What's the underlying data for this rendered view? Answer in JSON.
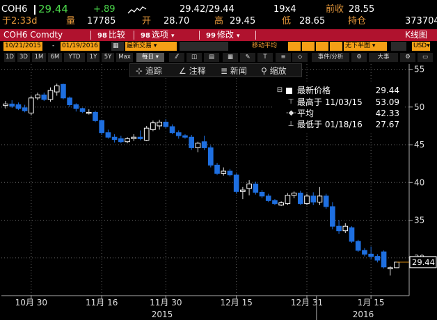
{
  "quote": {
    "ticker": "COH6",
    "last": "29.44",
    "change": "+.89",
    "bid_ask": "29.42/29.44",
    "size": "19x4",
    "prev_close_label": "前收",
    "prev_close": "28.55",
    "time_label": "于",
    "time": "2:33d",
    "volume_label": "量",
    "volume": "17785",
    "open_label": "开",
    "open": "28.70",
    "high_label": "高",
    "high": "29.45",
    "low_label": "低",
    "low": "28.65",
    "oi_label": "持仓",
    "oi": "373704"
  },
  "titlebar": {
    "security": "COH6 Comdty",
    "compare_num": "98",
    "compare": "比较",
    "options_num": "98",
    "options": "选项",
    "edit_num": "99",
    "edit": "修改",
    "chart_type": "K线图"
  },
  "controls": {
    "start_date": "10/21/2015",
    "end_date": "01/19/2016",
    "last_trade": "最新交易",
    "moving_avg": "移动平均",
    "no_lower": "无下半图",
    "currency": "USD"
  },
  "ranges": [
    "1D",
    "3D",
    "1M",
    "6M",
    "YTD",
    "1Y",
    "5Y",
    "Max"
  ],
  "range_selected": "每日",
  "toolbar": {
    "event_label": "事件/分析",
    "large_label": "大事"
  },
  "tools": {
    "track": "追踪",
    "annotate": "注释",
    "news": "新闻",
    "zoom": "缩放"
  },
  "legend": {
    "last_label": "最新价格",
    "last_value": "29.44",
    "high_label": "最高于 11/03/15",
    "high_value": "53.09",
    "avg_label": "平均",
    "avg_value": "42.33",
    "low_label": "最低于 01/18/16",
    "low_value": "27.67"
  },
  "colors": {
    "up": "#ffffff",
    "down": "#1e6fe0",
    "title_bar": "#b0122e",
    "orange": "#f5a016",
    "grid": "#666666"
  },
  "chart_data": {
    "type": "candlestick",
    "ylim": [
      26,
      55
    ],
    "yticks": [
      30,
      35,
      40,
      45,
      50,
      55
    ],
    "xtick_labels": [
      "10月 30",
      "11月 16",
      "11月 30",
      "12月 15",
      "12月 31",
      "1月 15"
    ],
    "year_labels": [
      "2015",
      "2016"
    ],
    "last_value_label": "29.44",
    "candles": [
      {
        "o": 50.2,
        "h": 50.8,
        "l": 49.8,
        "c": 50.4
      },
      {
        "o": 50.4,
        "h": 50.9,
        "l": 49.9,
        "c": 50.1
      },
      {
        "o": 50.3,
        "h": 50.6,
        "l": 49.6,
        "c": 49.8
      },
      {
        "o": 49.9,
        "h": 50.3,
        "l": 49.3,
        "c": 49.5
      },
      {
        "o": 49.2,
        "h": 51.5,
        "l": 48.9,
        "c": 51.2
      },
      {
        "o": 51.2,
        "h": 51.9,
        "l": 50.9,
        "c": 51.6
      },
      {
        "o": 51.6,
        "h": 51.9,
        "l": 50.8,
        "c": 51.0
      },
      {
        "o": 51.0,
        "h": 52.6,
        "l": 50.7,
        "c": 52.2
      },
      {
        "o": 52.0,
        "h": 53.09,
        "l": 51.5,
        "c": 52.8
      },
      {
        "o": 53.0,
        "h": 53.09,
        "l": 51.0,
        "c": 51.2
      },
      {
        "o": 51.2,
        "h": 51.4,
        "l": 50.0,
        "c": 50.3
      },
      {
        "o": 50.3,
        "h": 50.5,
        "l": 49.4,
        "c": 49.8
      },
      {
        "o": 49.8,
        "h": 49.9,
        "l": 49.2,
        "c": 49.4
      },
      {
        "o": 49.3,
        "h": 49.7,
        "l": 49.0,
        "c": 49.3
      },
      {
        "o": 49.3,
        "h": 49.5,
        "l": 48.0,
        "c": 48.2
      },
      {
        "o": 48.2,
        "h": 48.3,
        "l": 46.3,
        "c": 46.6
      },
      {
        "o": 46.6,
        "h": 47.0,
        "l": 45.8,
        "c": 46.0
      },
      {
        "o": 46.0,
        "h": 46.4,
        "l": 45.3,
        "c": 45.7
      },
      {
        "o": 45.8,
        "h": 46.2,
        "l": 45.2,
        "c": 45.4
      },
      {
        "o": 45.4,
        "h": 46.0,
        "l": 45.2,
        "c": 45.8
      },
      {
        "o": 45.8,
        "h": 46.4,
        "l": 45.5,
        "c": 46.0
      },
      {
        "o": 46.0,
        "h": 46.9,
        "l": 45.6,
        "c": 45.8
      },
      {
        "o": 45.6,
        "h": 47.5,
        "l": 45.5,
        "c": 47.2
      },
      {
        "o": 47.0,
        "h": 48.2,
        "l": 46.8,
        "c": 47.9
      },
      {
        "o": 47.5,
        "h": 48.3,
        "l": 47.0,
        "c": 48.0
      },
      {
        "o": 48.0,
        "h": 48.4,
        "l": 47.2,
        "c": 47.4
      },
      {
        "o": 47.4,
        "h": 47.7,
        "l": 46.4,
        "c": 46.6
      },
      {
        "o": 46.6,
        "h": 46.9,
        "l": 45.8,
        "c": 46.2
      },
      {
        "o": 46.2,
        "h": 46.4,
        "l": 45.8,
        "c": 46.0
      },
      {
        "o": 46.0,
        "h": 46.3,
        "l": 44.3,
        "c": 44.6
      },
      {
        "o": 44.6,
        "h": 45.4,
        "l": 44.0,
        "c": 45.2
      },
      {
        "o": 45.4,
        "h": 46.2,
        "l": 44.3,
        "c": 44.6
      },
      {
        "o": 44.6,
        "h": 44.9,
        "l": 42.0,
        "c": 42.3
      },
      {
        "o": 42.3,
        "h": 42.6,
        "l": 41.0,
        "c": 41.2
      },
      {
        "o": 41.2,
        "h": 42.0,
        "l": 40.9,
        "c": 41.5
      },
      {
        "o": 41.5,
        "h": 41.8,
        "l": 40.8,
        "c": 41.0
      },
      {
        "o": 41.0,
        "h": 41.2,
        "l": 38.5,
        "c": 38.8
      },
      {
        "o": 38.8,
        "h": 39.4,
        "l": 37.8,
        "c": 39.0
      },
      {
        "o": 39.2,
        "h": 40.3,
        "l": 38.3,
        "c": 39.8
      },
      {
        "o": 39.8,
        "h": 40.1,
        "l": 38.4,
        "c": 38.7
      },
      {
        "o": 38.7,
        "h": 39.0,
        "l": 37.9,
        "c": 38.2
      },
      {
        "o": 38.2,
        "h": 38.5,
        "l": 37.4,
        "c": 37.6
      },
      {
        "o": 37.6,
        "h": 37.8,
        "l": 37.0,
        "c": 37.2
      },
      {
        "o": 37.0,
        "h": 37.5,
        "l": 36.9,
        "c": 37.3
      },
      {
        "o": 37.2,
        "h": 38.6,
        "l": 37.0,
        "c": 38.3
      },
      {
        "o": 38.3,
        "h": 38.8,
        "l": 37.9,
        "c": 38.6
      },
      {
        "o": 38.6,
        "h": 38.9,
        "l": 37.0,
        "c": 37.2
      },
      {
        "o": 37.2,
        "h": 38.5,
        "l": 37.0,
        "c": 38.2
      },
      {
        "o": 38.2,
        "h": 38.7,
        "l": 37.0,
        "c": 37.4
      },
      {
        "o": 37.4,
        "h": 39.4,
        "l": 37.0,
        "c": 38.2
      },
      {
        "o": 38.2,
        "h": 38.5,
        "l": 36.5,
        "c": 36.8
      },
      {
        "o": 36.8,
        "h": 37.4,
        "l": 33.8,
        "c": 34.2
      },
      {
        "o": 34.2,
        "h": 35.0,
        "l": 33.2,
        "c": 33.6
      },
      {
        "o": 33.6,
        "h": 34.6,
        "l": 33.3,
        "c": 34.2
      },
      {
        "o": 34.0,
        "h": 34.2,
        "l": 32.0,
        "c": 32.2
      },
      {
        "o": 32.2,
        "h": 32.4,
        "l": 30.8,
        "c": 31.0
      },
      {
        "o": 31.0,
        "h": 31.3,
        "l": 30.2,
        "c": 30.5
      },
      {
        "o": 30.5,
        "h": 31.5,
        "l": 29.8,
        "c": 30.2
      },
      {
        "o": 30.2,
        "h": 30.5,
        "l": 29.4,
        "c": 29.7
      },
      {
        "o": 30.8,
        "h": 31.0,
        "l": 28.6,
        "c": 28.8
      },
      {
        "o": 28.55,
        "h": 28.9,
        "l": 27.67,
        "c": 28.7
      },
      {
        "o": 28.7,
        "h": 29.45,
        "l": 28.65,
        "c": 29.44
      }
    ]
  }
}
